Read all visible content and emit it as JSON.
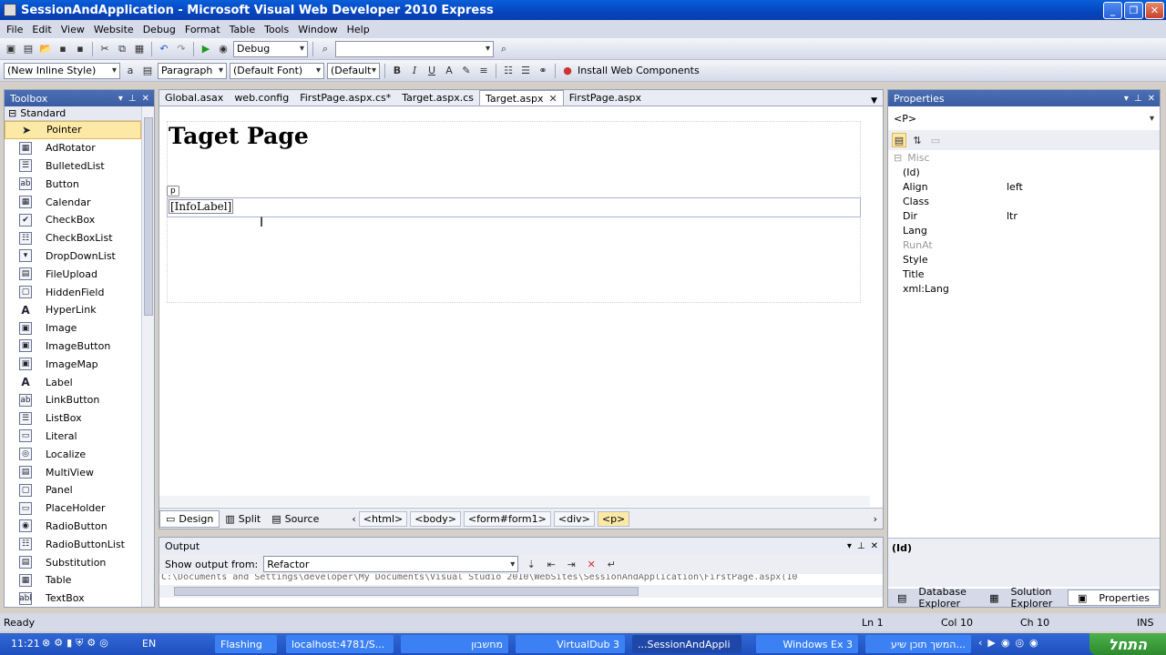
{
  "window": {
    "title": "SessionAndApplication - Microsoft Visual Web Developer 2010 Express"
  },
  "menu": [
    "File",
    "Edit",
    "View",
    "Website",
    "Debug",
    "Format",
    "Table",
    "Tools",
    "Window",
    "Help"
  ],
  "toolbar1": {
    "config": "Debug",
    "search": ""
  },
  "toolbar2": {
    "style": "(New Inline Style)",
    "block": "Paragraph",
    "font": "(Default Font)",
    "size": "(Default",
    "install": "Install Web Components"
  },
  "toolbox": {
    "title": "Toolbox",
    "group": "Standard",
    "items": [
      {
        "label": "Pointer",
        "icon": "pointer-icon",
        "glyph": "➤"
      },
      {
        "label": "AdRotator",
        "icon": "adrotator-icon",
        "glyph": "▦"
      },
      {
        "label": "BulletedList",
        "icon": "bulletedlist-icon",
        "glyph": "☰"
      },
      {
        "label": "Button",
        "icon": "button-icon",
        "glyph": "ab"
      },
      {
        "label": "Calendar",
        "icon": "calendar-icon",
        "glyph": "▦"
      },
      {
        "label": "CheckBox",
        "icon": "checkbox-icon",
        "glyph": "✔"
      },
      {
        "label": "CheckBoxList",
        "icon": "checkboxlist-icon",
        "glyph": "☷"
      },
      {
        "label": "DropDownList",
        "icon": "dropdownlist-icon",
        "glyph": "▾"
      },
      {
        "label": "FileUpload",
        "icon": "fileupload-icon",
        "glyph": "▤"
      },
      {
        "label": "HiddenField",
        "icon": "hiddenfield-icon",
        "glyph": "▢"
      },
      {
        "label": "HyperLink",
        "icon": "hyperlink-icon",
        "glyph": "A"
      },
      {
        "label": "Image",
        "icon": "image-icon",
        "glyph": "▣"
      },
      {
        "label": "ImageButton",
        "icon": "imagebutton-icon",
        "glyph": "▣"
      },
      {
        "label": "ImageMap",
        "icon": "imagemap-icon",
        "glyph": "▣"
      },
      {
        "label": "Label",
        "icon": "label-icon",
        "glyph": "A"
      },
      {
        "label": "LinkButton",
        "icon": "linkbutton-icon",
        "glyph": "ab"
      },
      {
        "label": "ListBox",
        "icon": "listbox-icon",
        "glyph": "☰"
      },
      {
        "label": "Literal",
        "icon": "literal-icon",
        "glyph": "▭"
      },
      {
        "label": "Localize",
        "icon": "localize-icon",
        "glyph": "◎"
      },
      {
        "label": "MultiView",
        "icon": "multiview-icon",
        "glyph": "▤"
      },
      {
        "label": "Panel",
        "icon": "panel-icon",
        "glyph": "▢"
      },
      {
        "label": "PlaceHolder",
        "icon": "placeholder-icon",
        "glyph": "▭"
      },
      {
        "label": "RadioButton",
        "icon": "radiobutton-icon",
        "glyph": "◉"
      },
      {
        "label": "RadioButtonList",
        "icon": "radiobuttonlist-icon",
        "glyph": "☷"
      },
      {
        "label": "Substitution",
        "icon": "substitution-icon",
        "glyph": "▤"
      },
      {
        "label": "Table",
        "icon": "table-icon",
        "glyph": "▦"
      },
      {
        "label": "TextBox",
        "icon": "textbox-icon",
        "glyph": "abl"
      }
    ]
  },
  "tabs": [
    "Global.asax",
    "web.config",
    "FirstPage.aspx.cs*",
    "Target.aspx.cs",
    "Target.aspx",
    "FirstPage.aspx"
  ],
  "active_tab": "Target.aspx",
  "design": {
    "heading": "Taget Page",
    "p_tag": "p",
    "info_label": "[InfoLabel]"
  },
  "viewbar": {
    "design": "Design",
    "split": "Split",
    "source": "Source",
    "crumbs": [
      "<html>",
      "<body>",
      "<form#form1>",
      "<div>",
      "<p>"
    ]
  },
  "output": {
    "title": "Output",
    "show_from_label": "Show output from:",
    "source": "Refactor",
    "text": "C:\\Documents and Settings\\developer\\My Documents\\Visual Studio 2010\\WebSites\\SessionAndApplication\\FirstPage.aspx(10"
  },
  "properties": {
    "title": "Properties",
    "selected": "<P>",
    "category": "Misc",
    "rows": [
      {
        "name": "(Id)",
        "value": ""
      },
      {
        "name": "Align",
        "value": "left"
      },
      {
        "name": "Class",
        "value": ""
      },
      {
        "name": "Dir",
        "value": "ltr"
      },
      {
        "name": "Lang",
        "value": ""
      },
      {
        "name": "RunAt",
        "value": ""
      },
      {
        "name": "Style",
        "value": ""
      },
      {
        "name": "Title",
        "value": ""
      },
      {
        "name": "xml:Lang",
        "value": ""
      }
    ],
    "description": "(Id)",
    "bottom_tabs": [
      "Database Explorer",
      "Solution Explorer",
      "Properties"
    ]
  },
  "status": {
    "ready": "Ready",
    "ln": "Ln 1",
    "col": "Col 10",
    "ch": "Ch 10",
    "ins": "INS"
  },
  "taskbar": {
    "clock": "11:21",
    "lang": "EN",
    "tasks": [
      "Flashing",
      "localhost:4781/S...",
      "מחשבון",
      "VirtualDub 3",
      "...SessionAndAppli",
      "Windows Ex 3",
      "המשך תוכן שיע..."
    ],
    "start": "התחל"
  }
}
